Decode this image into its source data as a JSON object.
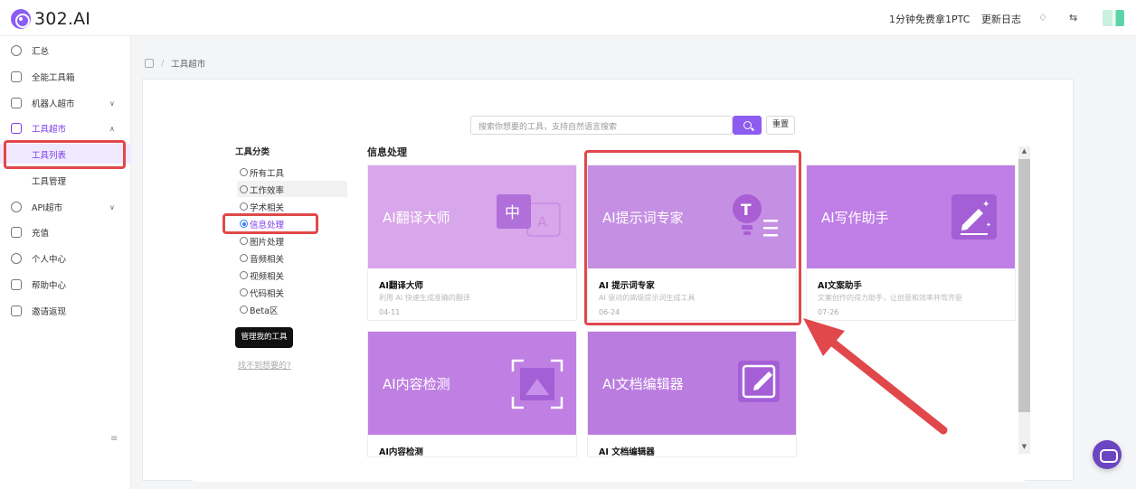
{
  "header": {
    "logo": "302.AI",
    "promo": "1分钟免费拿1PTC",
    "changelog": "更新日志"
  },
  "sidebar": {
    "items": [
      {
        "label": "汇总"
      },
      {
        "label": "全能工具箱"
      },
      {
        "label": "机器人超市"
      },
      {
        "label": "工具超市"
      },
      {
        "label": "API超市"
      },
      {
        "label": "充值"
      },
      {
        "label": "个人中心"
      },
      {
        "label": "帮助中心"
      },
      {
        "label": "邀请返现"
      }
    ],
    "sub_items": [
      {
        "label": "工具列表"
      },
      {
        "label": "工具管理"
      }
    ]
  },
  "breadcrumb": {
    "current": "工具超市"
  },
  "search": {
    "placeholder": "搜索你想要的工具，支持自然语言搜索",
    "reset": "重置"
  },
  "categories": {
    "title": "工具分类",
    "items": [
      "所有工具",
      "工作效率",
      "学术相关",
      "信息处理",
      "图片处理",
      "音频相关",
      "视频相关",
      "代码相关",
      "Beta区"
    ],
    "selected": "信息处理",
    "manage_button": "管理我的工具",
    "not_found": "找不到想要的?"
  },
  "section": {
    "title": "信息处理"
  },
  "cards": [
    {
      "banner": "AI翻译大师",
      "title": "AI翻译大师",
      "desc": "利用 AI 快速生成准确的翻译",
      "date": "04-11",
      "bg": "#d8a6ea",
      "icon": "translate-icon"
    },
    {
      "banner": "AI提示词专家",
      "title": "AI 提示词专家",
      "desc": "AI 驱动的高级提示词生成工具",
      "date": "06-24",
      "bg": "#c58fe3",
      "icon": "prompt-icon"
    },
    {
      "banner": "AI写作助手",
      "title": "AI文案助手",
      "desc": "文案创作的得力助手，让创意和效率并驾齐驱",
      "date": "07-26",
      "bg": "#bf7fe6",
      "icon": "writing-icon"
    },
    {
      "banner": "AI内容检测",
      "title": "AI内容检测",
      "desc": "",
      "date": "",
      "bg": "#c07fe2",
      "icon": "scan-icon"
    },
    {
      "banner": "AI文档编辑器",
      "title": "AI 文档编辑器",
      "desc": "",
      "date": "",
      "bg": "#bb7ce0",
      "icon": "edit-doc-icon"
    }
  ],
  "colors": {
    "accent": "#7c3aed",
    "highlight": "#e0484b"
  }
}
